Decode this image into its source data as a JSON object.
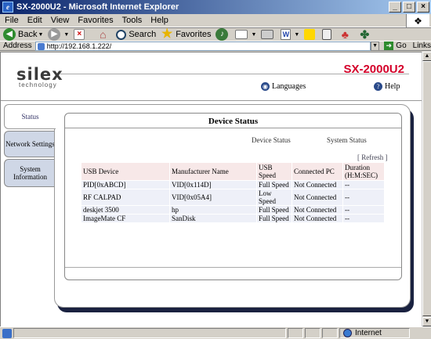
{
  "window": {
    "title": "SX-2000U2 - Microsoft Internet Explorer",
    "controls": [
      "_",
      "□",
      "×"
    ]
  },
  "menu": [
    "File",
    "Edit",
    "View",
    "Favorites",
    "Tools",
    "Help"
  ],
  "toolbar": {
    "back": "Back",
    "search": "Search",
    "favorites": "Favorites"
  },
  "address": {
    "label": "Address",
    "url": "http://192.168.1.222/",
    "go": "Go",
    "links": "Links"
  },
  "page": {
    "logo": "silex",
    "logo_sub": "technology",
    "product": "SX-2000U2",
    "languages": "Languages",
    "help": "Help",
    "tabs": [
      "Status",
      "Network Settings",
      "System Information"
    ],
    "panel_title": "Device Status",
    "subtabs": [
      "Device Status",
      "System Status"
    ],
    "refresh": "[ Refresh ]",
    "table": {
      "headers": [
        "USB Device",
        "Manufacturer Name",
        "USB Speed",
        "Connected PC",
        "Duration (H:M:SEC)"
      ],
      "rows": [
        [
          "PID[0xABCD]",
          "VID[0x114D]",
          "Full Speed",
          "Not Connected",
          "--"
        ],
        [
          "RF CALPAD",
          "VID[0x05A4]",
          "Low Speed",
          "Not Connected",
          "--"
        ],
        [
          "deskjet 3500",
          "hp",
          "Full Speed",
          "Not Connected",
          "--"
        ],
        [
          "ImageMate CF",
          "SanDisk",
          "Full Speed",
          "Not Connected",
          "--"
        ]
      ]
    }
  },
  "status": {
    "zone": "Internet"
  }
}
